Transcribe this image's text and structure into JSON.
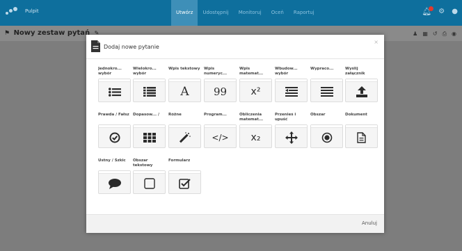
{
  "topbar": {
    "brand": "Pulpit",
    "nav": [
      "Utwórz",
      "Udostępnij",
      "Monitoruj",
      "Oceń",
      "Raportuj"
    ],
    "active_index": 0,
    "accent": "#0e6f9d",
    "icons": [
      "bell-icon",
      "gear-icon",
      "user-icon"
    ]
  },
  "subheader": {
    "title": "Nowy zestaw pytań",
    "icons": [
      "pin-icon",
      "pencil-icon",
      "person-icon",
      "grid-icon",
      "undo-icon",
      "print-icon",
      "eye-icon"
    ]
  },
  "modal": {
    "title": "Dodaj nowe pytanie",
    "close": "×",
    "cancel": "Anuluj",
    "tiles": [
      {
        "label": "Jednokro... wybór",
        "icon": "list-icon"
      },
      {
        "label": "Wielokro... wybór",
        "icon": "multi-list-icon"
      },
      {
        "label": "Wpis tekstowy",
        "icon": "text-icon",
        "glyph": "A"
      },
      {
        "label": "Wpis numeryc...",
        "icon": "number-icon",
        "glyph": "99"
      },
      {
        "label": "Wpis matemat...",
        "icon": "math-icon",
        "glyph": "x²"
      },
      {
        "label": "Wbudow... wybór",
        "icon": "embedded-choice-icon"
      },
      {
        "label": "Wypraco...",
        "icon": "essay-icon"
      },
      {
        "label": "Wyślij załącznik",
        "icon": "upload-icon"
      },
      {
        "label": "Prawda / Fałsz",
        "icon": "true-false-icon"
      },
      {
        "label": "Dopasow... /",
        "icon": "matching-grid-icon"
      },
      {
        "label": "Różne",
        "icon": "magic-wand-icon"
      },
      {
        "label": "Program...",
        "icon": "code-icon",
        "glyph": "</>"
      },
      {
        "label": "Obliczenia matemat...",
        "icon": "calculation-icon",
        "glyph": "x₂"
      },
      {
        "label": "Przenieś i upuść",
        "icon": "drag-drop-icon"
      },
      {
        "label": "Obszar",
        "icon": "hotspot-icon"
      },
      {
        "label": "Dokument",
        "icon": "document-icon"
      },
      {
        "label": "Ustny / Szkic",
        "icon": "speech-bubble-icon"
      },
      {
        "label": "Obszar tekstowy",
        "icon": "text-area-icon"
      },
      {
        "label": "Formularz",
        "icon": "form-checkbox-icon"
      }
    ]
  }
}
